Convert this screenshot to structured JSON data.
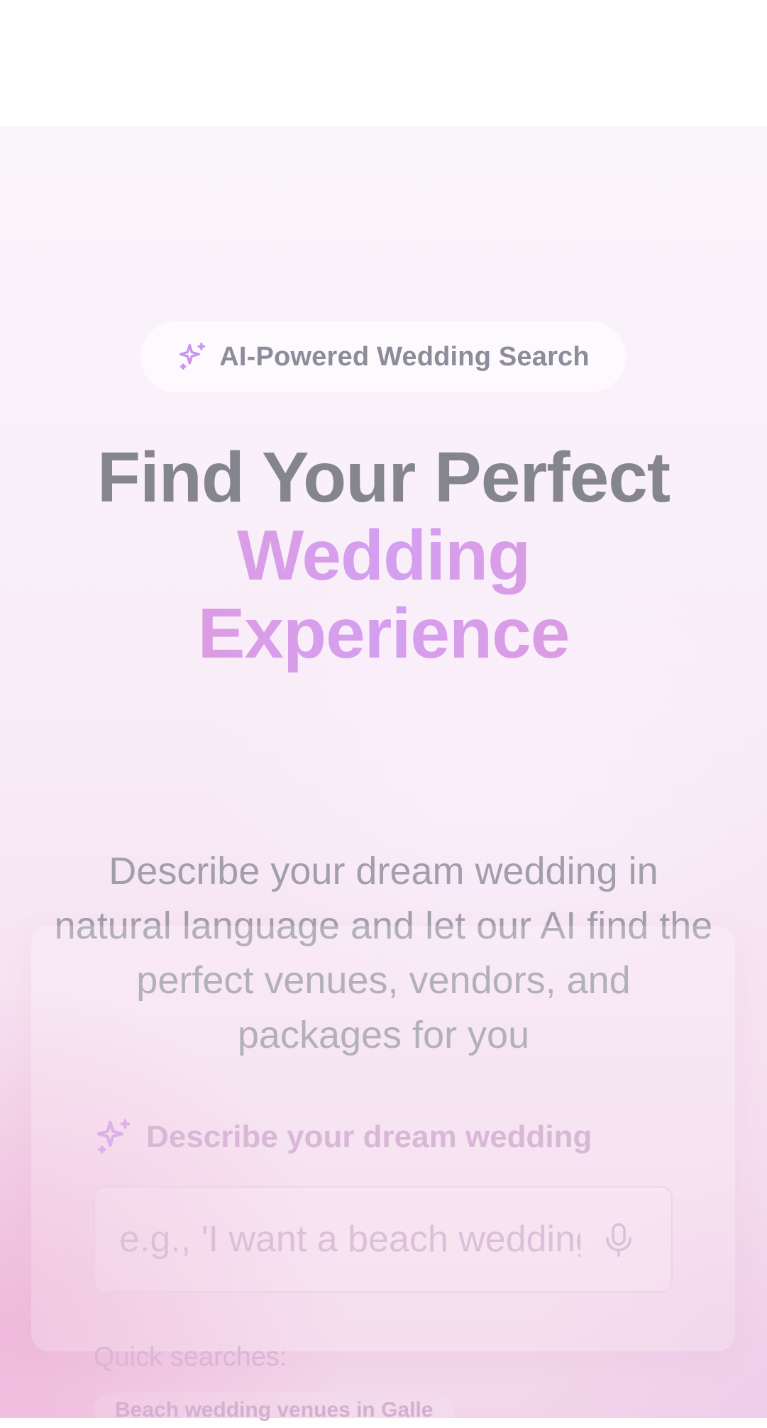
{
  "badge": {
    "icon": "sparkles-icon",
    "label": "AI-Powered Wedding Search"
  },
  "hero": {
    "title_line1": "Find Your Perfect",
    "title_line2": "Wedding",
    "title_line3": "Experience",
    "subtitle": "Describe your dream wedding in natural language and let our AI find the perfect venues, vendors, and packages for you"
  },
  "search_card": {
    "icon": "sparkles-icon",
    "heading": "Describe your dream wedding",
    "input_placeholder": "e.g., 'I want a beach wedding",
    "mic_icon": "microphone-icon",
    "quick_label": "Quick searches:",
    "quick_searches": [
      "Beach wedding venues in Galle"
    ]
  },
  "colors": {
    "accent_pink": "#e29ad8",
    "accent_purple": "#d49ff0",
    "title_gray": "#85858f",
    "text_gray": "#a19fab"
  }
}
